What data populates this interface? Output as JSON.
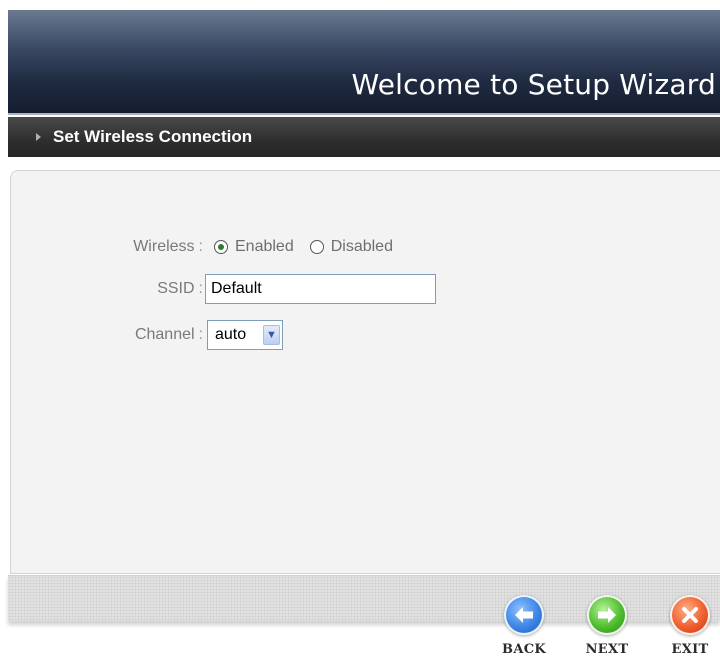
{
  "header": {
    "title": "Welcome to Setup Wizard"
  },
  "section": {
    "title": "Set Wireless Connection"
  },
  "form": {
    "wireless": {
      "label": "Wireless",
      "options": [
        {
          "label": "Enabled",
          "selected": true
        },
        {
          "label": "Disabled",
          "selected": false
        }
      ]
    },
    "ssid": {
      "label": "SSID",
      "value": "Default"
    },
    "channel": {
      "label": "Channel",
      "value": "auto"
    },
    "colon": ":"
  },
  "buttons": {
    "back": {
      "label": "BACK",
      "icon": "back-arrow-icon",
      "color": "#3d86e6"
    },
    "next": {
      "label": "NEXT",
      "icon": "next-arrow-icon",
      "color": "#4fbe2f"
    },
    "exit": {
      "label": "EXIT",
      "icon": "exit-x-icon",
      "color": "#f0602e"
    }
  }
}
